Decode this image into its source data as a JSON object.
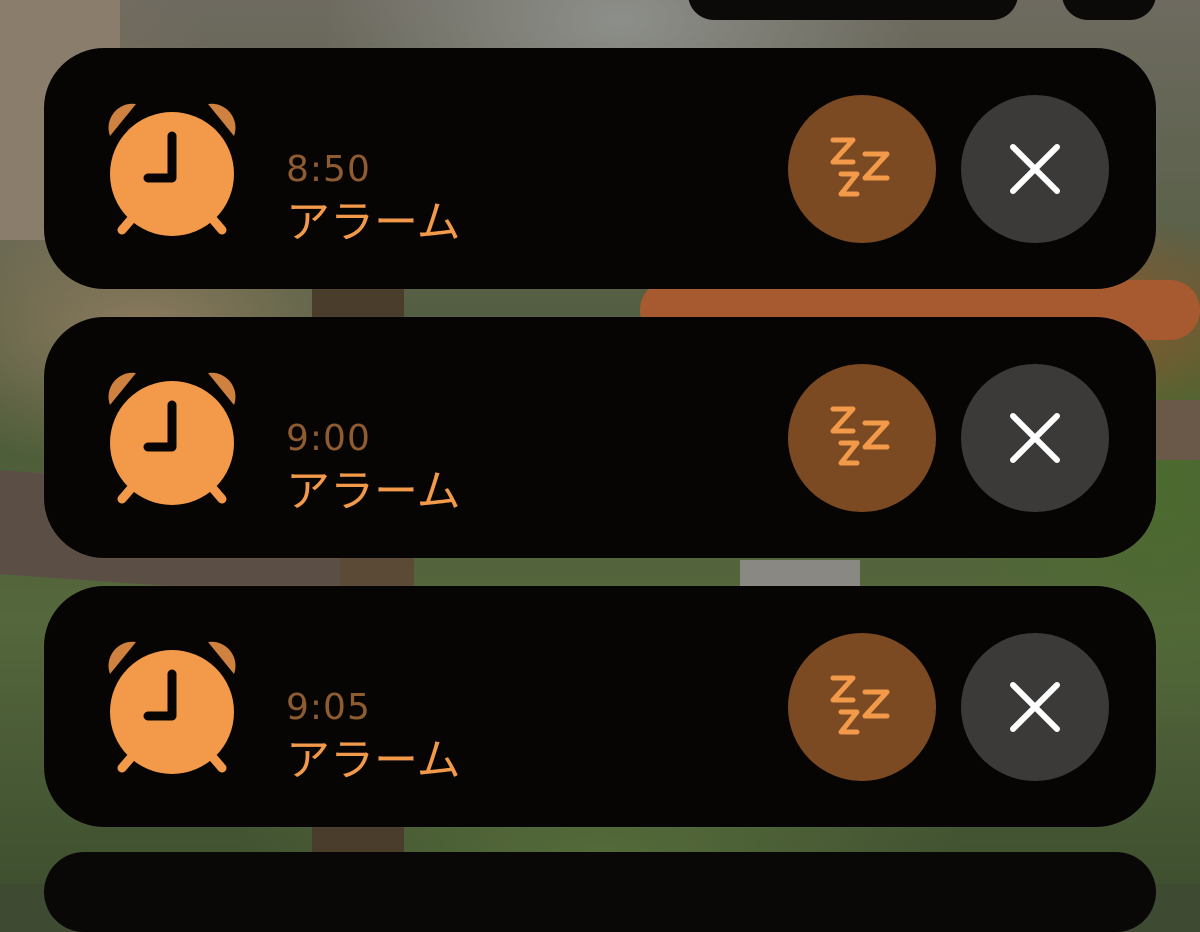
{
  "alarms": [
    {
      "time": "8:50",
      "label": "アラーム"
    },
    {
      "time": "9:00",
      "label": "アラーム"
    },
    {
      "time": "9:05",
      "label": "アラーム"
    }
  ],
  "icons": {
    "clock": "alarm-clock-icon",
    "snooze": "snooze-zzz-icon",
    "dismiss": "close-x-icon"
  },
  "colors": {
    "accent": "#f2994a",
    "time_text": "#8f5b30",
    "snooze_bg": "#7b4a22",
    "dismiss_bg": "#3b3a38",
    "card_bg": "#070504"
  }
}
